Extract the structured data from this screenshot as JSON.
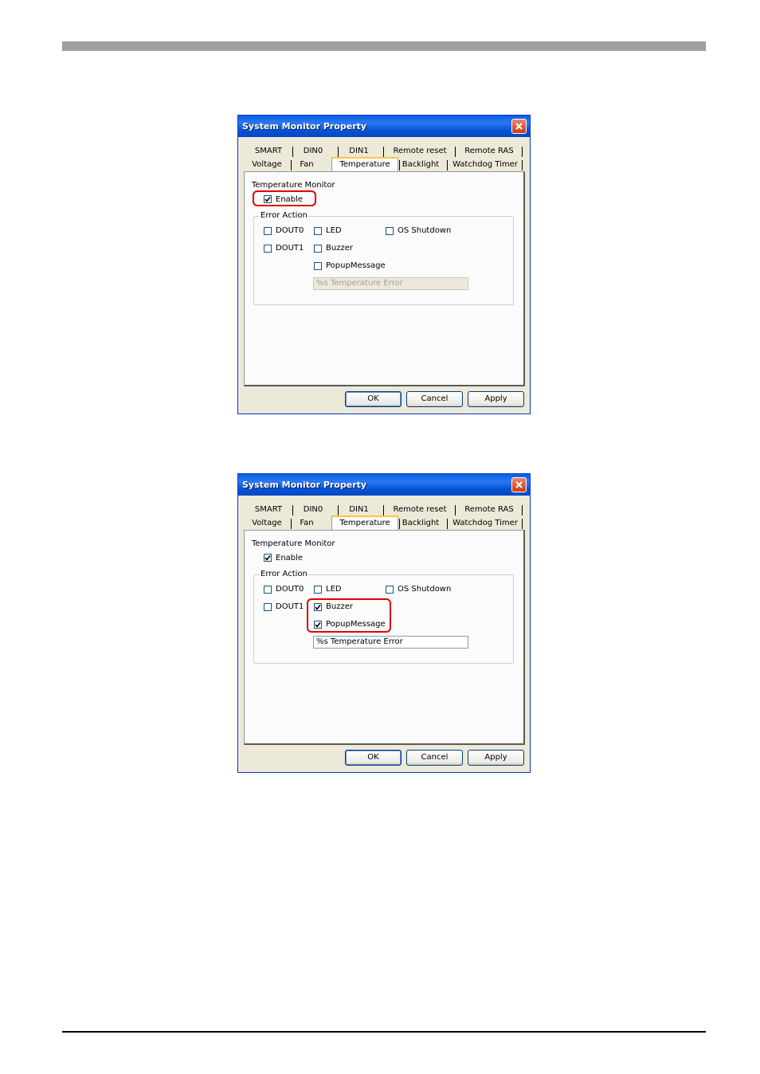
{
  "dialogs": [
    {
      "title": "System Monitor Property",
      "tabs_row1": [
        "SMART",
        "DIN0",
        "DIN1",
        "Remote reset",
        "Remote RAS"
      ],
      "tabs_row2": [
        "Voltage",
        "Fan",
        "Temperature",
        "Backlight",
        "Watchdog Timer"
      ],
      "active_tab": "Temperature",
      "monitor_label": "Temperature Monitor",
      "enable_label": "Enable",
      "enable_checked": true,
      "group_title": "Error Action",
      "actions": {
        "dout0": {
          "label": "DOUT0",
          "checked": false
        },
        "dout1": {
          "label": "DOUT1",
          "checked": false
        },
        "led": {
          "label": "LED",
          "checked": false
        },
        "buzzer": {
          "label": "Buzzer",
          "checked": false
        },
        "popup": {
          "label": "PopupMessage",
          "checked": false
        },
        "os_shutdown": {
          "label": "OS Shutdown",
          "checked": false
        }
      },
      "message_value": "%s Temperature Error",
      "message_enabled": false,
      "buttons": {
        "ok": "OK",
        "cancel": "Cancel",
        "apply": "Apply"
      },
      "highlighted": "Enable"
    },
    {
      "title": "System Monitor Property",
      "tabs_row1": [
        "SMART",
        "DIN0",
        "DIN1",
        "Remote reset",
        "Remote RAS"
      ],
      "tabs_row2": [
        "Voltage",
        "Fan",
        "Temperature",
        "Backlight",
        "Watchdog Timer"
      ],
      "active_tab": "Temperature",
      "monitor_label": "Temperature Monitor",
      "enable_label": "Enable",
      "enable_checked": true,
      "group_title": "Error Action",
      "actions": {
        "dout0": {
          "label": "DOUT0",
          "checked": false
        },
        "dout1": {
          "label": "DOUT1",
          "checked": false
        },
        "led": {
          "label": "LED",
          "checked": false
        },
        "buzzer": {
          "label": "Buzzer",
          "checked": true
        },
        "popup": {
          "label": "PopupMessage",
          "checked": true
        },
        "os_shutdown": {
          "label": "OS Shutdown",
          "checked": false
        }
      },
      "message_value": "%s Temperature Error",
      "message_enabled": true,
      "buttons": {
        "ok": "OK",
        "cancel": "Cancel",
        "apply": "Apply"
      },
      "highlighted": "Buzzer, PopupMessage"
    }
  ],
  "colors": {
    "highlight": "#e00000",
    "titlebar": "#0a5fe6",
    "dialog_bg": "#ece9d8"
  },
  "icons": {
    "close": "close-icon",
    "check": "checkmark-icon"
  }
}
